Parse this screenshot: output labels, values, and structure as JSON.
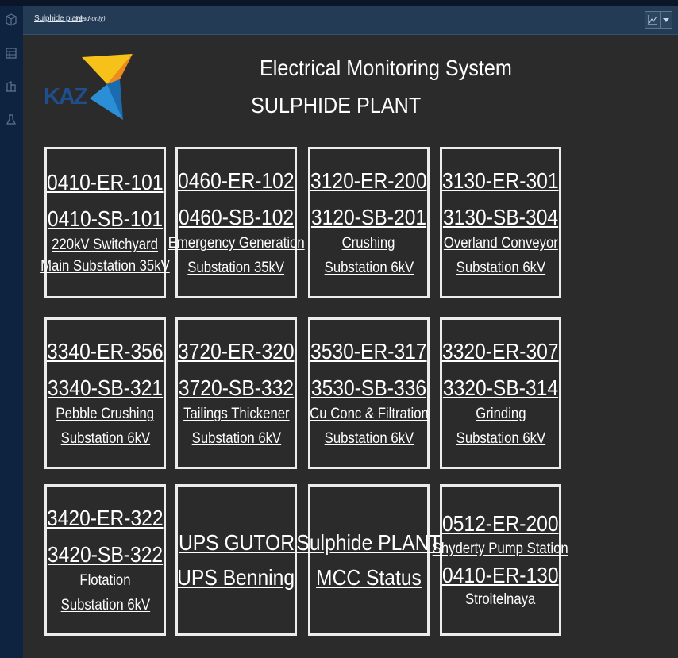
{
  "header": {
    "title": "Sulphide plant",
    "note": "(read-only)"
  },
  "sidebar": {
    "icons": [
      "cube-icon",
      "grid-icon",
      "building-icon",
      "beaker-icon"
    ]
  },
  "main": {
    "title": "Electrical Monitoring System",
    "subtitle": "SULPHIDE PLANT",
    "logo_text": "KAZ"
  },
  "tiles": [
    {
      "lines": [
        "0410-ER-101",
        "0410-SB-101",
        "220kV Switchyard",
        "Main Substation 35kV"
      ]
    },
    {
      "lines": [
        "0460-ER-102",
        "0460-SB-102",
        "Emergency Generation",
        "Substation 35kV"
      ]
    },
    {
      "lines": [
        "3120-ER-200",
        "3120-SB-201",
        "Crushing",
        "Substation 6kV"
      ]
    },
    {
      "lines": [
        "3130-ER-301",
        "3130-SB-304",
        "Overland Conveyor",
        "Substation 6kV"
      ]
    },
    {
      "lines": [
        "3340-ER-356",
        "3340-SB-321",
        "Pebble Crushing",
        "Substation 6kV"
      ]
    },
    {
      "lines": [
        "3720-ER-320",
        "3720-SB-332",
        "Tailings Thickener",
        "Substation 6kV"
      ]
    },
    {
      "lines": [
        "3530-ER-317",
        "3530-SB-336",
        "Cu Conc & Filtration",
        "Substation 6kV"
      ]
    },
    {
      "lines": [
        "3320-ER-307",
        "3320-SB-314",
        "Grinding",
        "Substation 6kV"
      ]
    },
    {
      "lines": [
        "3420-ER-322",
        "3420-SB-322",
        "Flotation",
        "Substation 6kV"
      ]
    },
    {
      "lines": [
        "UPS GUTOR",
        "UPS Benning"
      ]
    },
    {
      "lines": [
        "Sulphide PLANT",
        "MCC Status"
      ]
    },
    {
      "lines": [
        "0512-ER-200",
        "Shyderty Pump Station",
        "0410-ER-130",
        "Stroitelnaya"
      ]
    }
  ]
}
